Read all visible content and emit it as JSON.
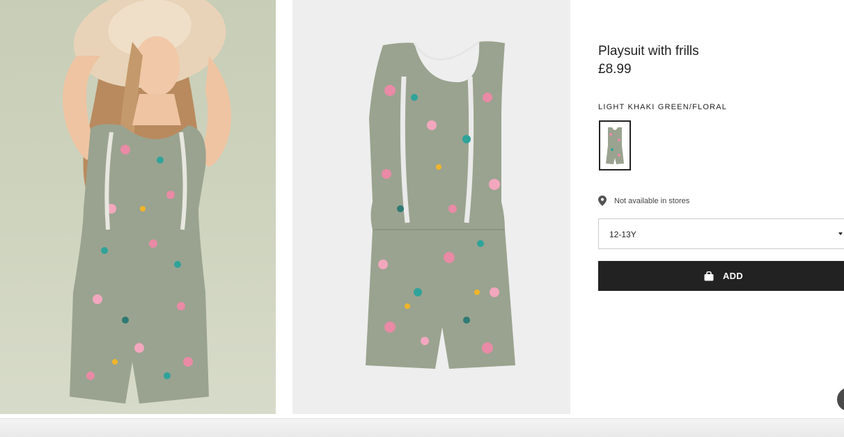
{
  "product": {
    "title": "Playsuit with frills",
    "price": "£8.99",
    "color_name": "LIGHT KHAKI GREEN/FLORAL",
    "availability_text": "Not available in stores",
    "selected_size": "12-13Y",
    "add_label": "ADD"
  },
  "images": {
    "model_photo": "model wearing floral playsuit and straw hat",
    "product_photo": "floral playsuit flat lay"
  },
  "icons": {
    "location": "location-pin-icon",
    "bag": "shopping-bag-icon",
    "dropdown": "caret-down-icon",
    "chat": "chat-icon"
  },
  "colors": {
    "fabric": "#9aa38f",
    "button": "#222222",
    "text": "#222222"
  }
}
